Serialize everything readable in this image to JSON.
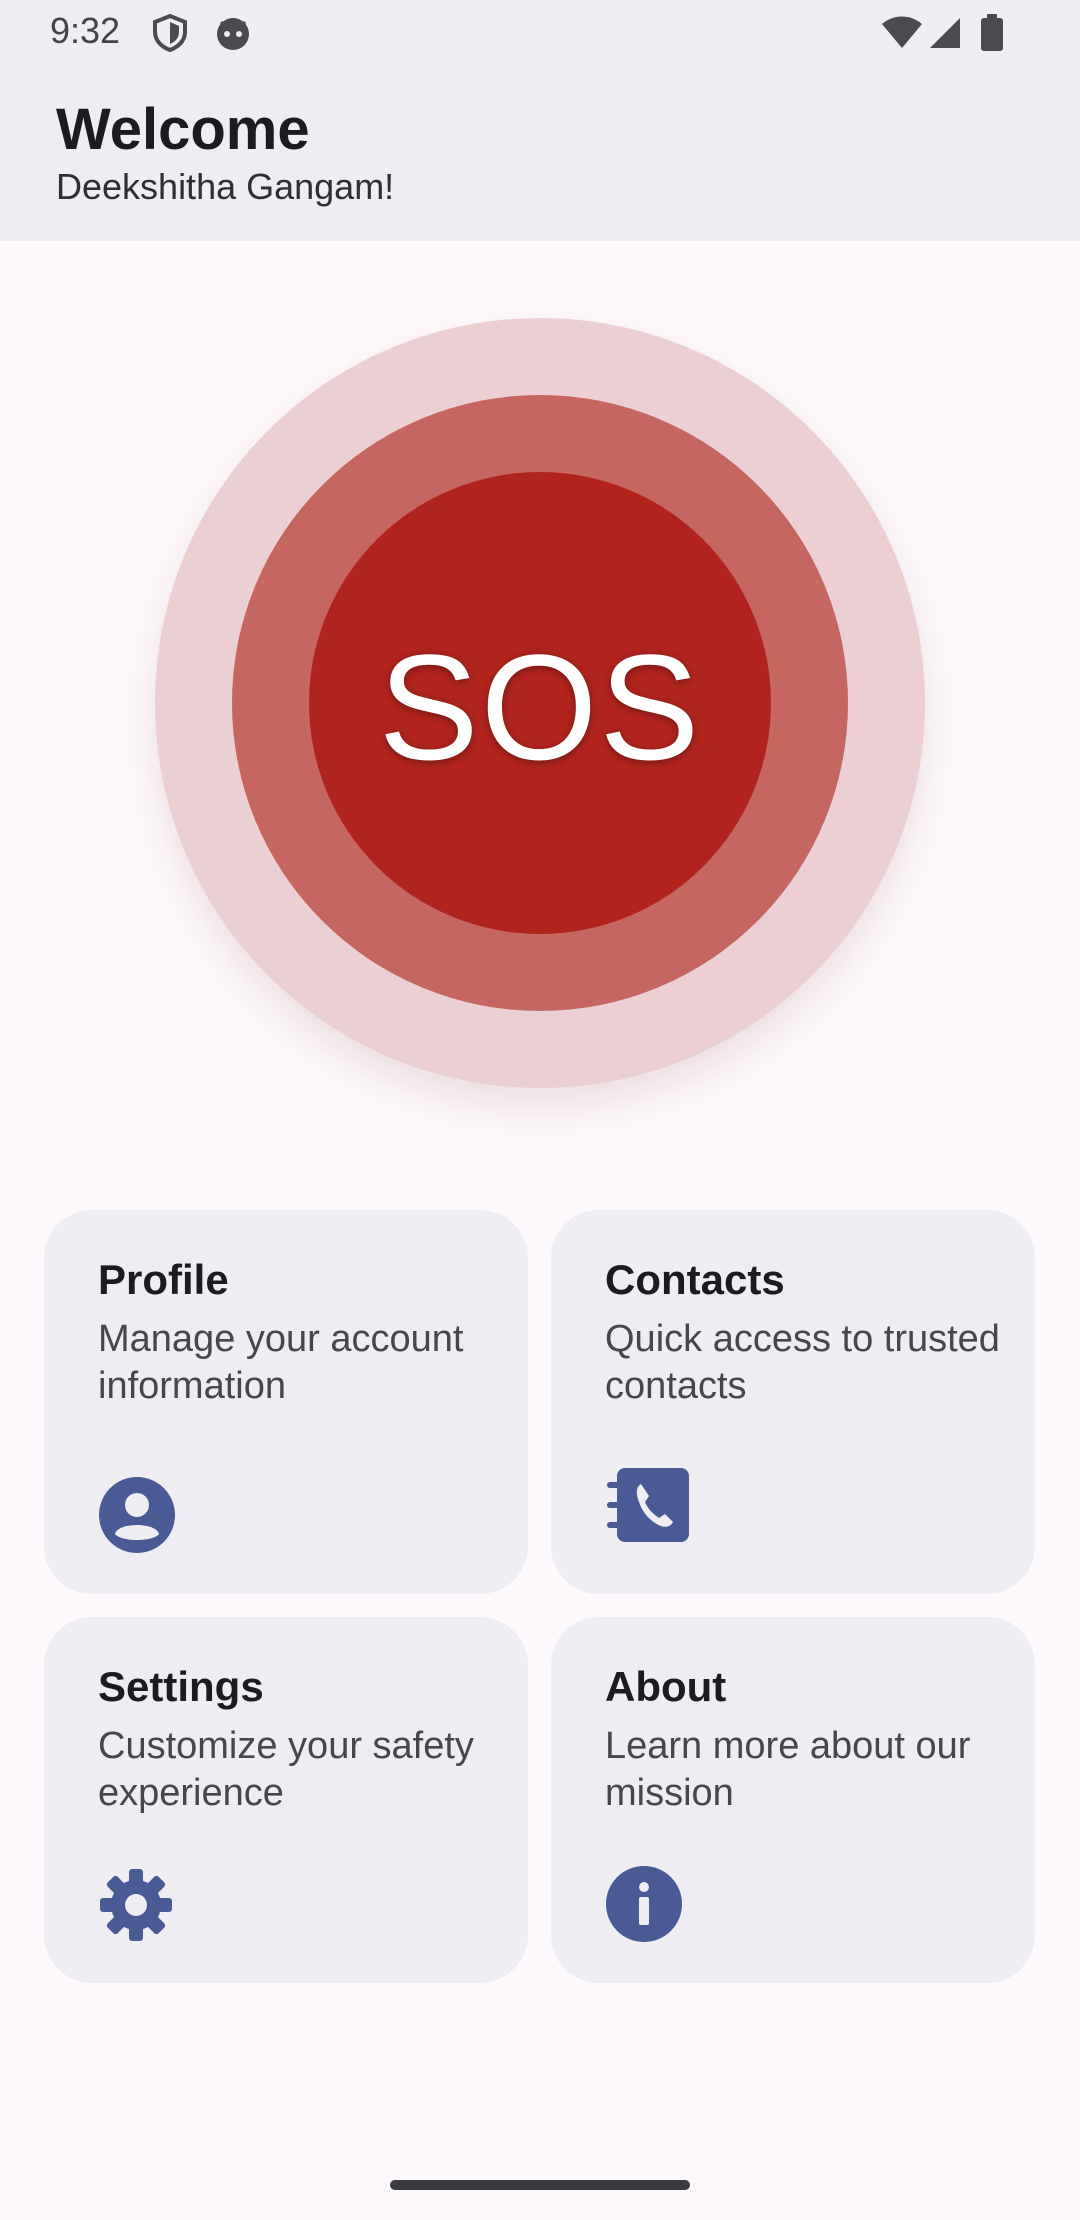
{
  "status_bar": {
    "time": "9:32",
    "icons_left": [
      "shield-icon",
      "android-head-icon"
    ],
    "icons_right": [
      "wifi-icon",
      "signal-icon",
      "battery-icon"
    ]
  },
  "header": {
    "title": "Welcome",
    "subtitle": "Deekshitha Gangam!"
  },
  "sos": {
    "label": "SOS",
    "colors": {
      "outer": "#ebcfd2",
      "middle": "#c66660",
      "inner": "#b0241d"
    }
  },
  "cards": [
    {
      "title": "Profile",
      "description": "Manage your account information",
      "icon": "account-circle-icon"
    },
    {
      "title": "Contacts",
      "description": "Quick access to trusted contacts",
      "icon": "contact-book-icon"
    },
    {
      "title": "Settings",
      "description": "Customize your safety experience",
      "icon": "gear-icon"
    },
    {
      "title": "About",
      "description": "Learn more about our mission",
      "icon": "info-icon"
    }
  ],
  "accent_color": "#4a5a94"
}
